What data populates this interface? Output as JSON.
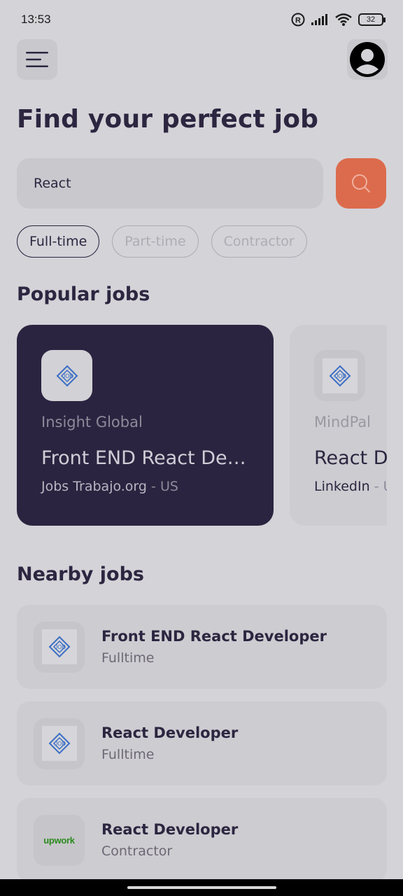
{
  "status_bar": {
    "time": "13:53",
    "battery": "32"
  },
  "header": {
    "menu_icon": "menu-icon",
    "avatar_icon": "user-avatar-icon"
  },
  "page": {
    "title": "Find your perfect job"
  },
  "search": {
    "value": "React",
    "button_icon": "search-icon"
  },
  "filters": [
    {
      "label": "Full-time",
      "active": true
    },
    {
      "label": "Part-time",
      "active": false
    },
    {
      "label": "Contractor",
      "active": false
    }
  ],
  "popular": {
    "title": "Popular jobs",
    "jobs": [
      {
        "company": "Insight Global",
        "title": "Front END React Developer",
        "publisher": "Jobs Trabajo.org",
        "country": "US",
        "logo": "job-logo-icon"
      },
      {
        "company": "MindPal",
        "title": "React Developer",
        "publisher": "LinkedIn",
        "country": "US",
        "logo": "job-logo-icon"
      }
    ]
  },
  "nearby": {
    "title": "Nearby jobs",
    "jobs": [
      {
        "title": "Front END React Developer",
        "type": "Fulltime",
        "logo": "job-logo-icon"
      },
      {
        "title": "React Developer",
        "type": "Fulltime",
        "logo": "job-logo-icon"
      },
      {
        "title": "React Developer",
        "type": "Contractor",
        "logo": "upwork-logo",
        "logo_text": "upwork"
      }
    ]
  },
  "colors": {
    "accent": "#dc6b4d",
    "primary": "#2c2640",
    "card_dark": "#2b2440",
    "background": "#d4d3d8"
  }
}
